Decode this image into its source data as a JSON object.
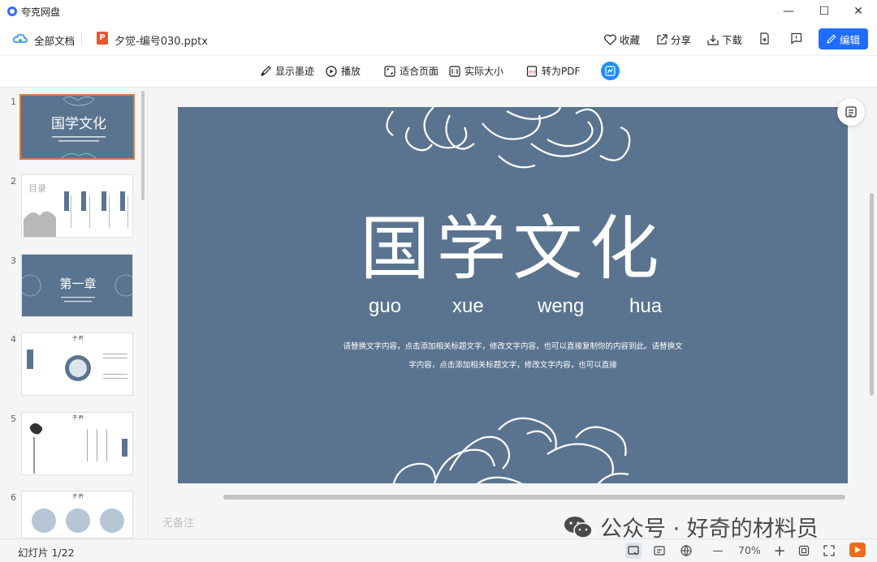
{
  "window": {
    "app_title": "夸克网盘",
    "minimize": "—",
    "maximize": "☐",
    "close": "✕"
  },
  "topbar": {
    "all_docs": "全部文档",
    "file_icon_letter": "P",
    "file_name": "夕觉-编号030.pptx",
    "favorite": "收藏",
    "share": "分享",
    "download": "下载",
    "edit": "编辑"
  },
  "toolbar": {
    "show_ink": "显示墨迹",
    "play": "播放",
    "fit_page": "适合页面",
    "actual_size": "实际大小",
    "to_pdf": "转为PDF"
  },
  "thumbnails": [
    {
      "num": "1",
      "title": "国学文化"
    },
    {
      "num": "2",
      "title": "目录"
    },
    {
      "num": "3",
      "title": "第一章"
    },
    {
      "num": "4",
      "title": "子·矜"
    },
    {
      "num": "5",
      "title": "子·矜"
    },
    {
      "num": "6",
      "title": "子·矜"
    }
  ],
  "slide": {
    "title": "国学文化",
    "pinyin": [
      "guo",
      "xue",
      "weng",
      "hua"
    ],
    "body_line1": "请替换文字内容，点击添加相关标题文字，修改文字内容，也可以直接复制你的内容到此。请替换文",
    "body_line2": "字内容，点击添加相关标题文字，修改文字内容，也可以直接",
    "bg_color": "#5a7490"
  },
  "notes_placeholder": "无备注",
  "watermark": "公众号 · 好奇的材料员",
  "status": {
    "slide_count": "幻灯片 1/22",
    "zoom": "70%",
    "zoom_minus": "—",
    "zoom_plus": "+"
  }
}
